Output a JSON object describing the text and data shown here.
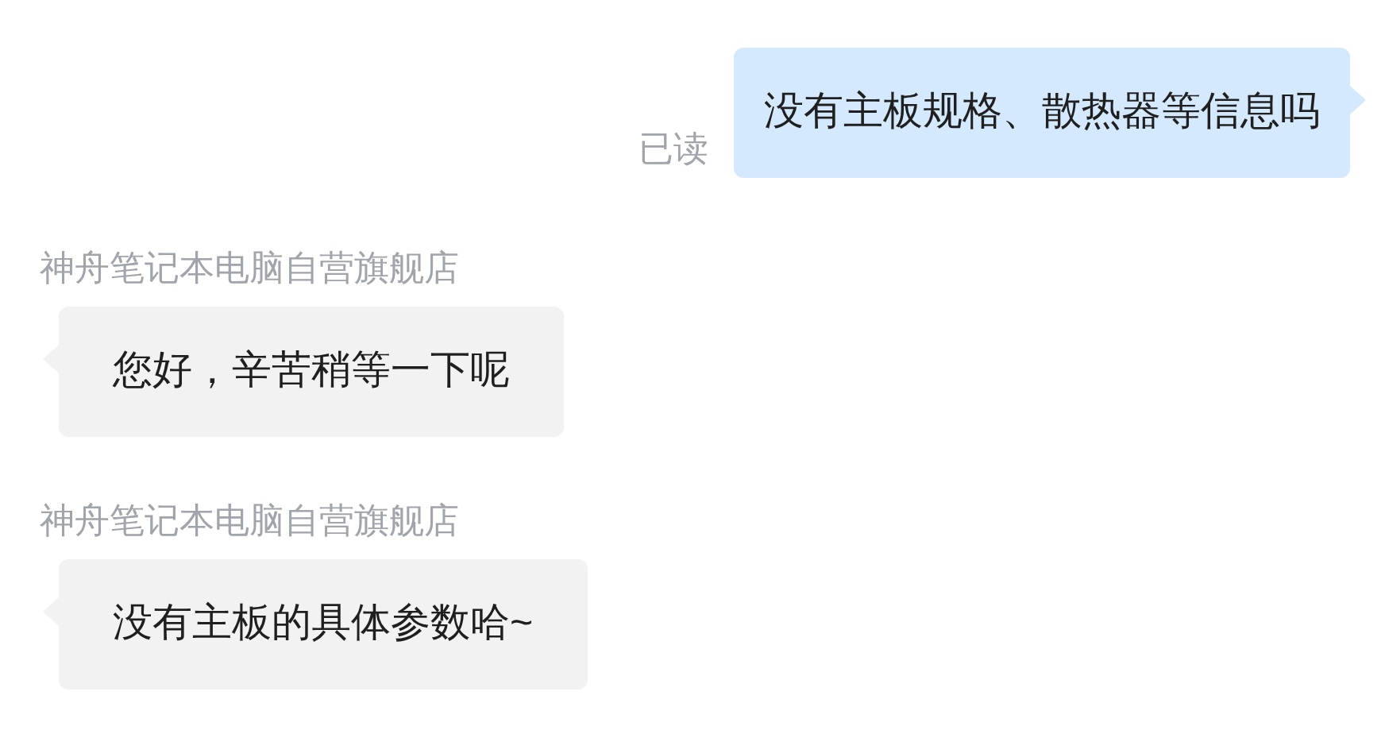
{
  "messages": [
    {
      "kind": "outgoing",
      "status": "已读",
      "text": "没有主板规格、散热器等信息吗"
    },
    {
      "kind": "incoming",
      "sender": "神舟笔记本电脑自营旗舰店",
      "text": "您好，辛苦稍等一下呢"
    },
    {
      "kind": "incoming",
      "sender": "神舟笔记本电脑自营旗舰店",
      "text": "没有主板的具体参数哈~"
    }
  ]
}
